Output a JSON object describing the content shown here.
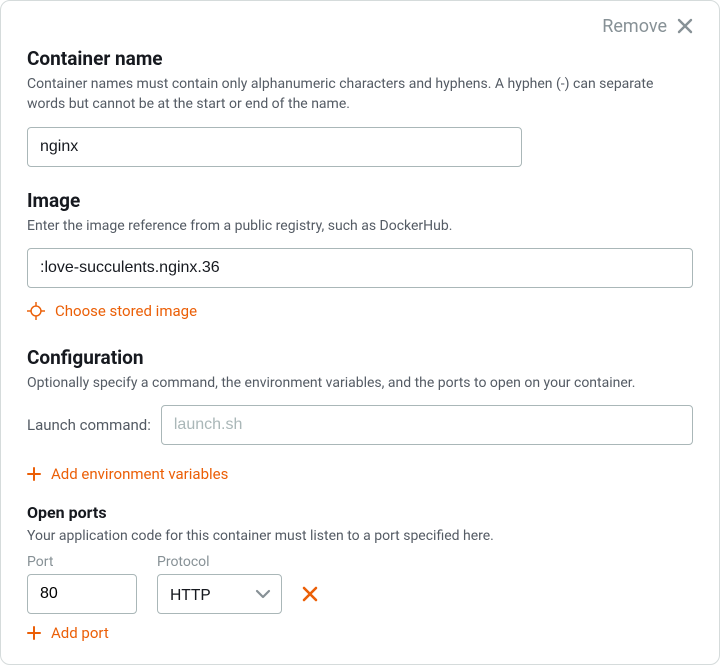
{
  "remove_label": "Remove",
  "container_name": {
    "title": "Container name",
    "desc": "Container names must contain only alphanumeric characters and hyphens. A hyphen (-) can separate words but cannot be at the start or end of the name.",
    "value": "nginx"
  },
  "image": {
    "title": "Image",
    "desc": "Enter the image reference from a public registry, such as DockerHub.",
    "value": ":love-succulents.nginx.36",
    "choose_stored": "Choose stored image"
  },
  "configuration": {
    "title": "Configuration",
    "desc": "Optionally specify a command, the environment variables, and the ports to open on your container.",
    "launch_label": "Launch command:",
    "launch_placeholder": "launch.sh",
    "add_env": "Add environment variables"
  },
  "open_ports": {
    "title": "Open ports",
    "desc": "Your application code for this container must listen to a port specified here.",
    "port_label": "Port",
    "protocol_label": "Protocol",
    "rows": [
      {
        "port": "80",
        "protocol": "HTTP"
      }
    ],
    "add_port": "Add port"
  }
}
